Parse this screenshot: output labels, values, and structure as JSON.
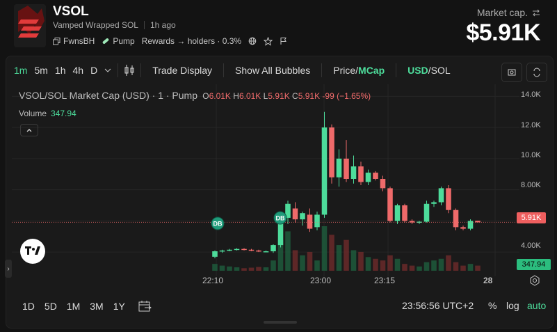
{
  "header": {
    "symbol": "VSOL",
    "full_name": "Vamped Wrapped SOL",
    "age": "1h ago",
    "creator": "FwnsBH",
    "platform": "Pump",
    "rewards": "Rewards → holders · 0.3%",
    "market_cap_label": "Market cap.",
    "market_cap_value": "$5.91K"
  },
  "toolbar": {
    "timeframes": [
      "1m",
      "5m",
      "1h",
      "4h",
      "D"
    ],
    "active_timeframe": "1m",
    "trade_display": "Trade Display",
    "show_bubbles": "Show All Bubbles",
    "price_label": "Price/",
    "mcap_label": "MCap",
    "usd_label": "USD",
    "sol_label": "/SOL"
  },
  "legend": {
    "title": "VSOL/SOL Market Cap (USD) · 1 · Pump",
    "o_label": "O",
    "o": "6.01K",
    "h_label": "H",
    "h": "6.01K",
    "l_label": "L",
    "l": "5.91K",
    "c_label": "C",
    "c": "5.91K",
    "change": "-99 (−1.65%)",
    "volume_label": "Volume",
    "volume_value": "347.94"
  },
  "chart_data": {
    "type": "candlestick",
    "title": "VSOL/SOL Market Cap (USD) · 1 · Pump",
    "y_ticks": [
      "14.0K",
      "12.0K",
      "10.0K",
      "8.00K",
      "4.00K"
    ],
    "ylim": [
      2800,
      14600
    ],
    "x_ticks": [
      "22:10",
      "23:00",
      "23:15",
      "28"
    ],
    "last_price_tag": "5.91K",
    "volume_tag": "347.94",
    "bubbles": [
      {
        "label": "DB"
      },
      {
        "label": "DB"
      }
    ],
    "candles": [
      {
        "o": 3700,
        "h": 4100,
        "l": 3600,
        "c": 4050
      },
      {
        "o": 4050,
        "h": 4150,
        "l": 3950,
        "c": 4100
      },
      {
        "o": 4100,
        "h": 4200,
        "l": 4050,
        "c": 4150
      },
      {
        "o": 4150,
        "h": 4250,
        "l": 4100,
        "c": 4200
      },
      {
        "o": 4200,
        "h": 4250,
        "l": 4100,
        "c": 4150
      },
      {
        "o": 4150,
        "h": 4200,
        "l": 4050,
        "c": 4100
      },
      {
        "o": 4100,
        "h": 4150,
        "l": 4000,
        "c": 4050
      },
      {
        "o": 4050,
        "h": 4100,
        "l": 4000,
        "c": 4050
      },
      {
        "o": 4050,
        "h": 4500,
        "l": 3950,
        "c": 4450
      },
      {
        "o": 4450,
        "h": 6300,
        "l": 4300,
        "c": 6200
      },
      {
        "o": 6200,
        "h": 7300,
        "l": 5800,
        "c": 7100
      },
      {
        "o": 6800,
        "h": 7200,
        "l": 5900,
        "c": 6100
      },
      {
        "o": 6100,
        "h": 6600,
        "l": 5700,
        "c": 6500
      },
      {
        "o": 6400,
        "h": 6800,
        "l": 5300,
        "c": 5500
      },
      {
        "o": 5600,
        "h": 6600,
        "l": 5400,
        "c": 6400
      },
      {
        "o": 6400,
        "h": 13000,
        "l": 6200,
        "c": 12000
      },
      {
        "o": 12000,
        "h": 12200,
        "l": 8400,
        "c": 8800
      },
      {
        "o": 8800,
        "h": 10600,
        "l": 8200,
        "c": 10000
      },
      {
        "o": 10000,
        "h": 11200,
        "l": 8500,
        "c": 8700
      },
      {
        "o": 8700,
        "h": 10200,
        "l": 8400,
        "c": 9500
      },
      {
        "o": 9500,
        "h": 9800,
        "l": 8300,
        "c": 8500
      },
      {
        "o": 8500,
        "h": 9300,
        "l": 8300,
        "c": 9100
      },
      {
        "o": 9100,
        "h": 9200,
        "l": 8600,
        "c": 8700
      },
      {
        "o": 8700,
        "h": 8900,
        "l": 7900,
        "c": 8100
      },
      {
        "o": 8100,
        "h": 8200,
        "l": 5900,
        "c": 6000
      },
      {
        "o": 6000,
        "h": 7100,
        "l": 5800,
        "c": 7000
      },
      {
        "o": 7000,
        "h": 7100,
        "l": 5900,
        "c": 6000
      },
      {
        "o": 6000,
        "h": 6100,
        "l": 5800,
        "c": 5900
      },
      {
        "o": 5900,
        "h": 6000,
        "l": 5800,
        "c": 5950
      },
      {
        "o": 5950,
        "h": 7300,
        "l": 5900,
        "c": 7100
      },
      {
        "o": 7100,
        "h": 7300,
        "l": 6900,
        "c": 7200
      },
      {
        "o": 7200,
        "h": 8200,
        "l": 7000,
        "c": 8100
      },
      {
        "o": 8100,
        "h": 8300,
        "l": 6500,
        "c": 6700
      },
      {
        "o": 6700,
        "h": 6800,
        "l": 5400,
        "c": 5600
      },
      {
        "o": 5600,
        "h": 5700,
        "l": 5400,
        "c": 5500
      },
      {
        "o": 5500,
        "h": 6100,
        "l": 5400,
        "c": 6000
      },
      {
        "o": 6010,
        "h": 6010,
        "l": 5910,
        "c": 5910
      }
    ],
    "volumes": [
      40,
      30,
      25,
      20,
      15,
      18,
      22,
      20,
      60,
      180,
      230,
      120,
      90,
      110,
      60,
      260,
      210,
      150,
      180,
      120,
      110,
      80,
      70,
      60,
      90,
      70,
      40,
      30,
      25,
      50,
      60,
      70,
      90,
      50,
      30,
      40,
      30
    ]
  },
  "bottom": {
    "ranges": [
      "1D",
      "5D",
      "1M",
      "3M",
      "1Y"
    ],
    "time": "23:56:56 UTC+2",
    "pct": "%",
    "log": "log",
    "auto": "auto"
  },
  "colors": {
    "up": "#4ddc9b",
    "down": "#ef6a6a",
    "accent": "#4ddc9b",
    "bubble": "#1f9b7a"
  }
}
